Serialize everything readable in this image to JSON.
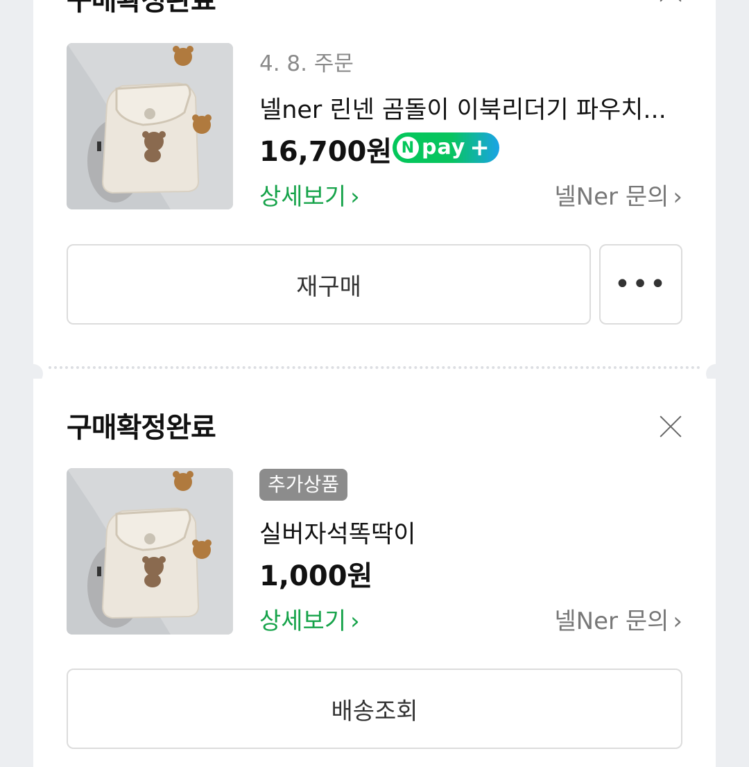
{
  "order1": {
    "status_title": "구매확정완료",
    "order_date": "4. 8. 주문",
    "product_name": "넬ner 린넨 곰돌이 이북리더기 파우치...",
    "price": "16,700원",
    "npay": {
      "n": "N",
      "pay": "pay",
      "plus": "+"
    },
    "detail_link": "상세보기",
    "inquiry_link": "넬Ner 문의",
    "rebuy_button": "재구매",
    "more_button": "•••"
  },
  "order2": {
    "status_title": "구매확정완료",
    "addon_badge": "추가상품",
    "product_name": "실버자석똑딱이",
    "price": "1,000원",
    "detail_link": "상세보기",
    "inquiry_link": "넬Ner 문의",
    "tracking_button": "배송조회"
  },
  "chevron": "›",
  "colors": {
    "background": "#eceef1",
    "card": "#ffffff",
    "link_green": "#16a34a",
    "badge_gray": "#8c8c8c",
    "npay_green": "#03c75a",
    "npay_blue": "#1aa3e6"
  },
  "icons": [
    "close-icon",
    "chevron-right-icon",
    "more-icon",
    "npay-logo"
  ]
}
